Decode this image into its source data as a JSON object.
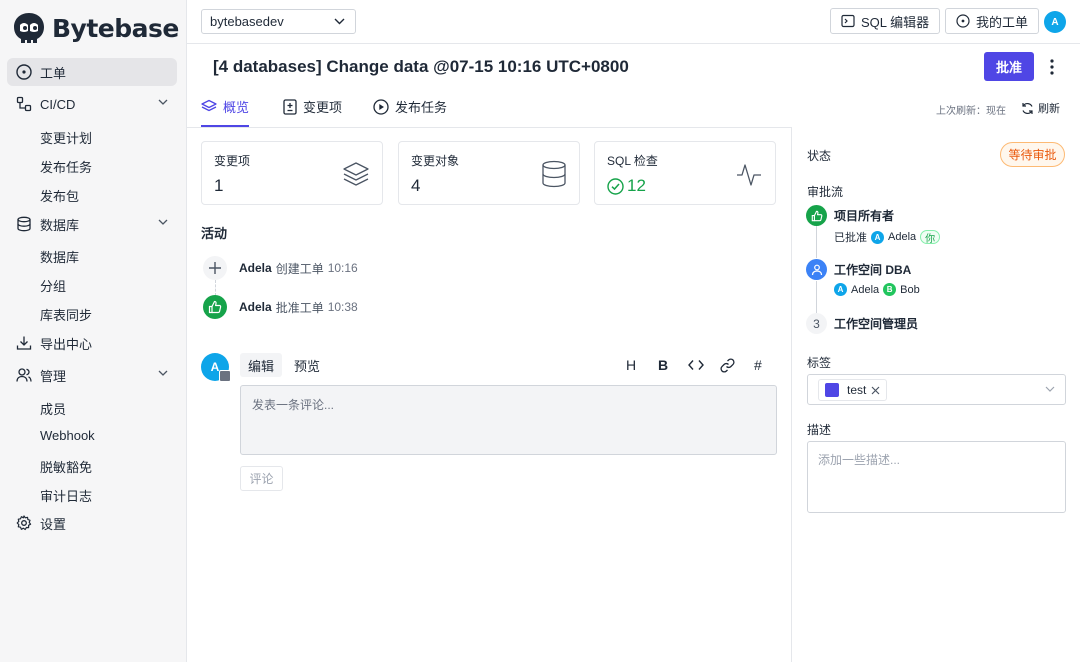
{
  "app": {
    "logo_text": "Bytebase"
  },
  "sidebar": {
    "items": [
      {
        "label": "工单",
        "icon": "circle-dot-icon",
        "active": true
      },
      {
        "label": "CI/CD",
        "icon": "workflow-icon",
        "expanded": true
      },
      {
        "label": "数据库",
        "icon": "database-icon",
        "expanded": true
      },
      {
        "label": "导出中心",
        "icon": "download-icon"
      },
      {
        "label": "管理",
        "icon": "users-icon",
        "expanded": true
      },
      {
        "label": "设置",
        "icon": "gear-icon"
      }
    ],
    "cicd_subitems": [
      "变更计划",
      "发布任务",
      "发布包"
    ],
    "database_subitems": [
      "数据库",
      "分组",
      "库表同步"
    ],
    "admin_subitems": [
      "成员",
      "Webhook",
      "脱敏豁免",
      "审计日志"
    ]
  },
  "topbar": {
    "project": "bytebasedev",
    "sql_editor_label": "SQL 编辑器",
    "my_issues_label": "我的工单",
    "user_initial": "A"
  },
  "issue": {
    "title": "[4 databases] Change data @07-15 10:16 UTC+0800",
    "approve_label": "批准"
  },
  "tabs": [
    {
      "label": "概览",
      "icon": "layers-icon",
      "active": true
    },
    {
      "label": "变更项",
      "icon": "diff-icon"
    },
    {
      "label": "发布任务",
      "icon": "play-circle-icon"
    }
  ],
  "refresh": {
    "info": "上次刷新：现在",
    "label": "刷新"
  },
  "cards": [
    {
      "label": "变更项",
      "value": "1",
      "icon": "layers-icon"
    },
    {
      "label": "变更对象",
      "value": "4",
      "icon": "database-icon"
    },
    {
      "label": "SQL 检查",
      "value": "12",
      "icon": "activity-icon"
    }
  ],
  "activity": {
    "title": "活动",
    "items": [
      {
        "user": "Adela",
        "action": "创建工单",
        "time": "10:16",
        "icon": "plus-icon"
      },
      {
        "user": "Adela",
        "action": "批准工单",
        "time": "10:38",
        "icon": "thumbs-up-icon"
      }
    ]
  },
  "comment": {
    "avatar": "A",
    "edit_tab": "编辑",
    "preview_tab": "预览",
    "format_buttons": [
      "H",
      "B",
      "<>",
      "link",
      "#"
    ],
    "placeholder": "发表一条评论...",
    "submit_label": "评论"
  },
  "right_panel": {
    "status_label": "状态",
    "status_value": "等待审批",
    "approval_flow_label": "审批流",
    "steps": [
      {
        "name": "项目所有者",
        "state": "approved",
        "sub_prefix": "已批准",
        "users": [
          {
            "initial": "A",
            "name": "Adela",
            "color": "#0ea5e9"
          }
        ],
        "you": "你"
      },
      {
        "name": "工作空间 DBA",
        "state": "current",
        "users": [
          {
            "initial": "A",
            "name": "Adela",
            "color": "#0ea5e9"
          },
          {
            "initial": "B",
            "name": "Bob",
            "color": "#22c55e"
          }
        ]
      },
      {
        "name": "工作空间管理员",
        "state": "pending",
        "number": "3"
      }
    ],
    "labels_label": "标签",
    "tag": {
      "name": "test",
      "color": "#4f46e5"
    },
    "description_label": "描述",
    "description_placeholder": "添加一些描述..."
  },
  "colors": {
    "accent": "#4f46e5",
    "success": "#16a34a",
    "warning": "#ea580c",
    "info": "#3b82f6"
  }
}
